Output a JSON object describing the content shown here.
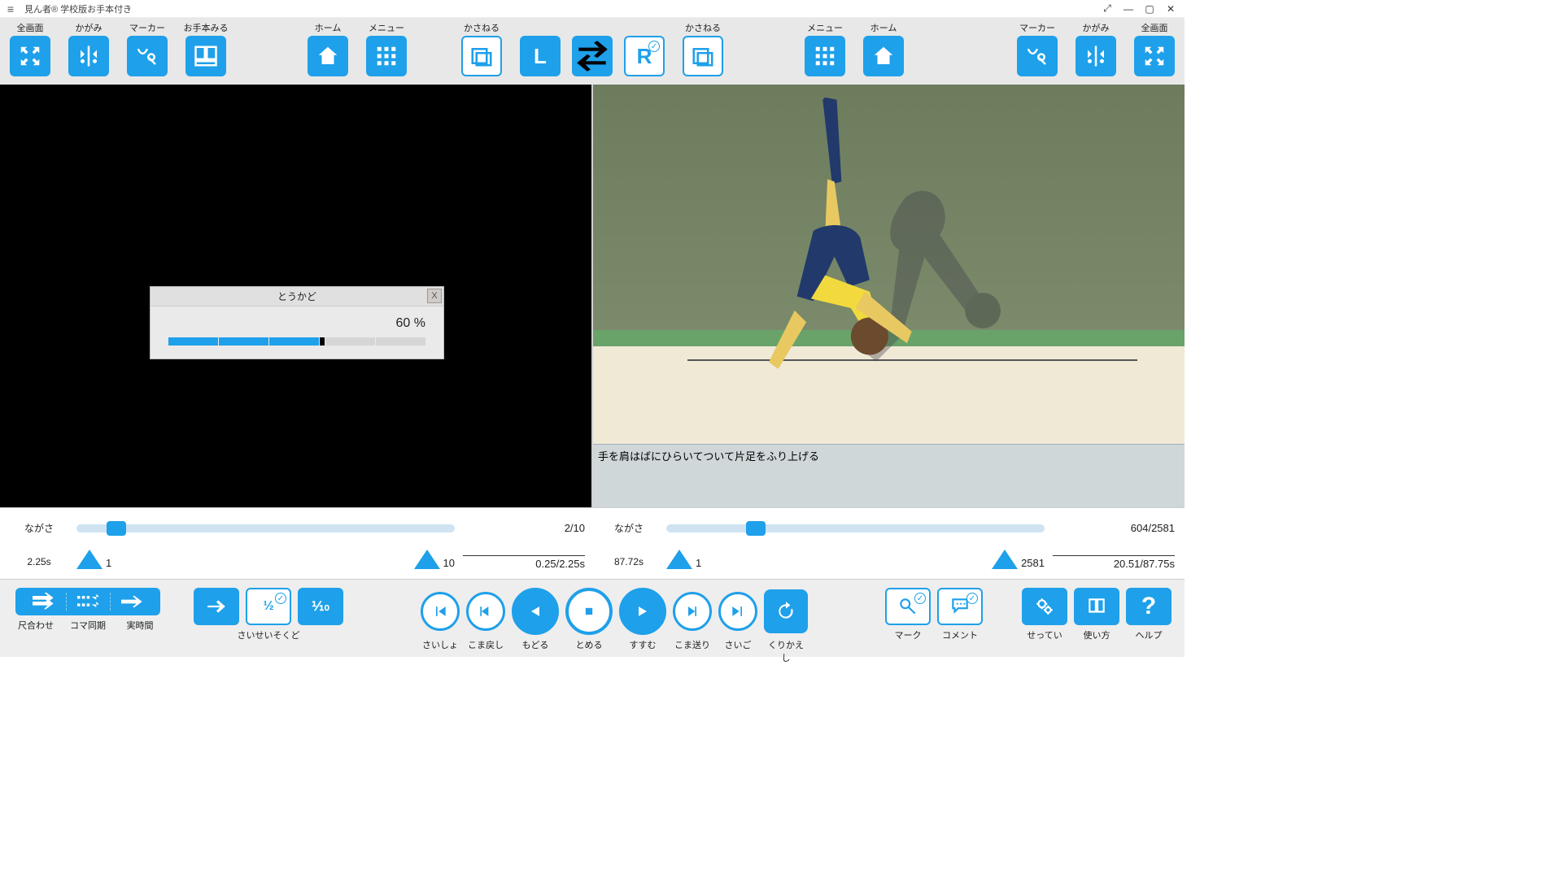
{
  "window": {
    "title": "見ん者® 学校版お手本付き"
  },
  "toolbar": {
    "left": {
      "fullscreen": "全画面",
      "mirror": "かがみ",
      "marker": "マーカー",
      "sample": "お手本みる",
      "home": "ホーム",
      "menu": "メニュー",
      "overlay": "かさねる",
      "side": "L"
    },
    "right": {
      "fullscreen": "全画面",
      "mirror": "かがみ",
      "marker": "マーカー",
      "home": "ホーム",
      "menu": "メニュー",
      "overlay": "かさねる",
      "side": "R"
    }
  },
  "dialog": {
    "title": "とうかど",
    "percent": "60 %",
    "value": 60
  },
  "caption": "手を肩はばにひらいてついて片足をふり上げる",
  "timeline": {
    "left": {
      "label": "ながさ",
      "length_sec": "2.25s",
      "frame": "2/10",
      "time": "0.25/2.25s",
      "start": "1",
      "end": "10",
      "thumb_pct": 8
    },
    "right": {
      "label": "ながさ",
      "length_sec": "87.72s",
      "frame": "604/2581",
      "time": "20.51/87.75s",
      "start": "1",
      "end": "2581",
      "thumb_pct": 21
    }
  },
  "bottom": {
    "fit": {
      "scale": "尺合わせ",
      "frame_sync": "コマ同期",
      "realtime": "実時間"
    },
    "speed": {
      "label": "さいせいそくど",
      "half": "½",
      "tenth": "⅒"
    },
    "play": {
      "first": "さいしょ",
      "frame_back": "こま戻し",
      "back": "もどる",
      "stop": "とめる",
      "fwd": "すすむ",
      "frame_fwd": "こま送り",
      "last": "さいご",
      "repeat": "くりかえし"
    },
    "mark": {
      "mark": "マーク",
      "comment": "コメント"
    },
    "sys": {
      "settings": "せってい",
      "guide": "使い方",
      "help": "ヘルプ"
    }
  }
}
